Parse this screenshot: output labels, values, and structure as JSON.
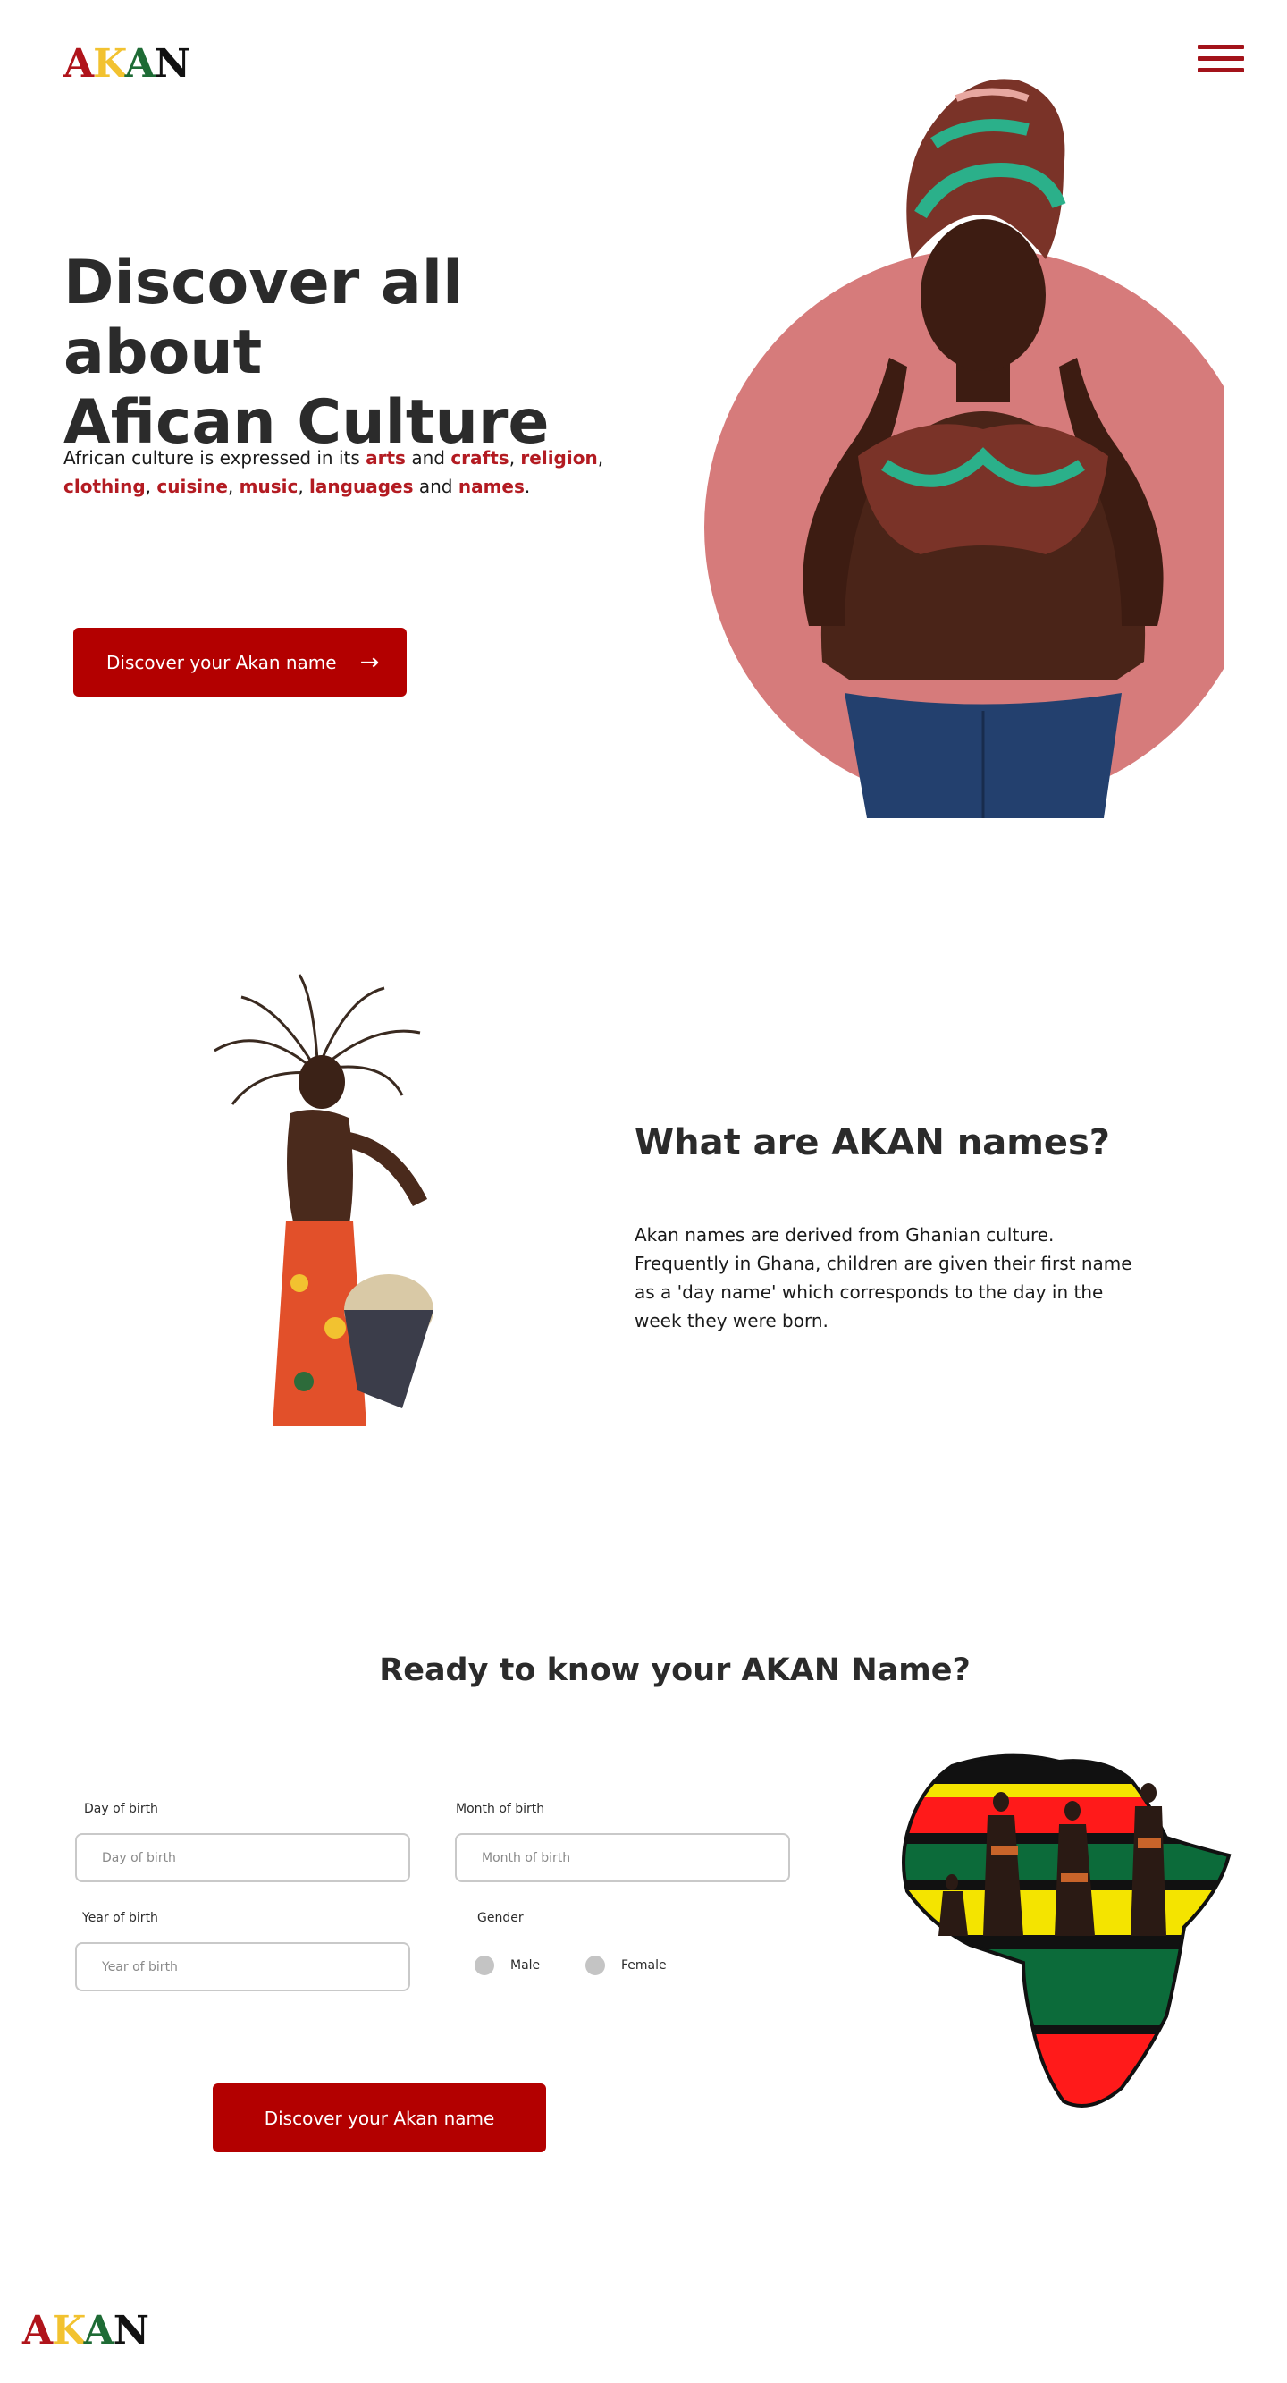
{
  "brand": {
    "logo_letters": [
      "A",
      "K",
      "A",
      "N"
    ]
  },
  "nav": {
    "menu_icon": "hamburger-menu-icon"
  },
  "hero": {
    "title_line1": "Discover all about",
    "title_line2": "Afican Culture",
    "text_parts": {
      "intro": "African culture is expressed in its ",
      "arts": "arts",
      "and1": " and ",
      "crafts": "crafts",
      "comma1": ", ",
      "religion": "religion",
      "comma2": ",",
      "clothing": "clothing",
      "comma3": ", ",
      "cuisine": "cuisine",
      "comma4": ", ",
      "music": "music",
      "comma5": ", ",
      "languages": "languages",
      "and2": " and ",
      "names": "names",
      "period": "."
    },
    "cta_label": "Discover your Akan name",
    "cta_icon": "arrow-right-icon"
  },
  "about": {
    "title": "What are AKAN names?",
    "text": "Akan names are derived from Ghanian culture. Frequently in Ghana, children are given their first name as a 'day name' which corresponds to the day in the week they were born."
  },
  "form": {
    "title": "Ready to know your AKAN Name?",
    "day": {
      "label": "Day of birth",
      "placeholder": "Day of birth"
    },
    "month": {
      "label": "Month of birth",
      "placeholder": "Month of birth"
    },
    "year": {
      "label": "Year of birth",
      "placeholder": "Year of birth"
    },
    "gender": {
      "label": "Gender",
      "options": [
        "Male",
        "Female"
      ]
    },
    "submit_label": "Discover your Akan name"
  },
  "colors": {
    "brand_red": "#b30000",
    "accent_text_red": "#b31b22",
    "logo_yellow": "#f2c230",
    "logo_green": "#1e6b35",
    "hero_circle": "#d67b7b"
  }
}
